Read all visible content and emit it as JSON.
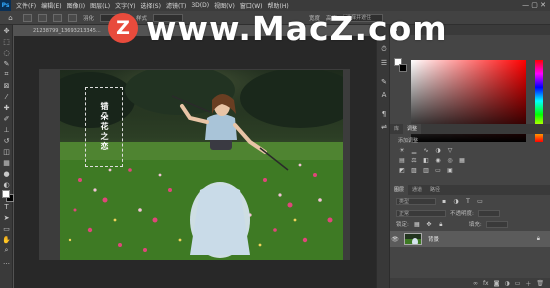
{
  "menu": {
    "app_icon": "Ps",
    "items": [
      "文件(F)",
      "编辑(E)",
      "图像(I)",
      "图层(L)",
      "文字(Y)",
      "选择(S)",
      "滤镜(T)",
      "3D(D)",
      "视图(V)",
      "窗口(W)",
      "帮助(H)"
    ]
  },
  "options": {
    "labels": [
      "羽化",
      "样式",
      "宽度",
      "高度",
      "选择并遮住"
    ]
  },
  "document": {
    "tab_title": "21238799_13693213345..."
  },
  "watermark": {
    "logo_letter": "Z",
    "text": "www.MacZ.com",
    "circle_color": "#e84b3c"
  },
  "canvas": {
    "vertical_text": "错朵花之恋"
  },
  "panels": {
    "adjust_tabs": [
      "库",
      "调整"
    ],
    "adjust_label": "添加调整",
    "layers_tabs": [
      "图层",
      "通道",
      "路径"
    ],
    "kind_label": "类型",
    "blend_mode": "正常",
    "opacity_label": "不透明度:",
    "lock_label": "锁定:",
    "fill_label": "填充:",
    "layer_name": "背景"
  }
}
